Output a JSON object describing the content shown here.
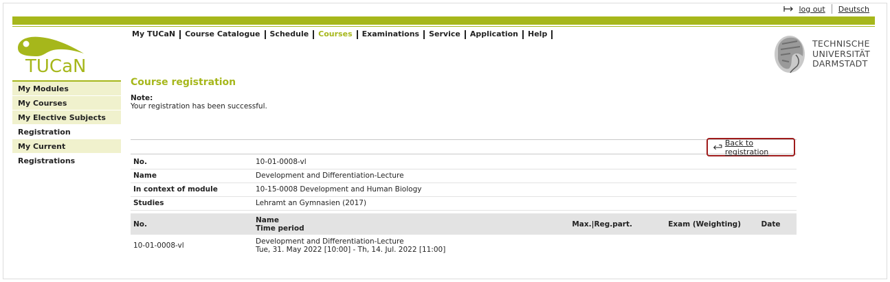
{
  "header": {
    "logout_label": "log out",
    "language_label": "Deutsch",
    "logo_text": "TUCaN",
    "university": [
      "TECHNISCHE",
      "UNIVERSITÄT",
      "DARMSTADT"
    ]
  },
  "nav": {
    "items": [
      {
        "label": "My TUCaN",
        "active": false
      },
      {
        "label": "Course Catalogue",
        "active": false
      },
      {
        "label": "Schedule",
        "active": false
      },
      {
        "label": "Courses",
        "active": true
      },
      {
        "label": "Examinations",
        "active": false
      },
      {
        "label": "Service",
        "active": false
      },
      {
        "label": "Application",
        "active": false
      },
      {
        "label": "Help",
        "active": false
      }
    ]
  },
  "sidebar": {
    "items": [
      {
        "label": "My Modules",
        "current": false
      },
      {
        "label": "My Courses",
        "current": false
      },
      {
        "label": "My Elective Subjects",
        "current": false
      },
      {
        "label": "Registration",
        "current": true
      },
      {
        "label": "My Current Registrations",
        "current": false
      }
    ]
  },
  "main": {
    "title": "Course registration",
    "note_label": "Note:",
    "note_text": "Your registration has been successful.",
    "back_label": "Back to registration",
    "details": [
      {
        "key": "No.",
        "value": "10-01-0008-vl"
      },
      {
        "key": "Name",
        "value": "Development and Differentiation-Lecture"
      },
      {
        "key": "In context of module",
        "value": "10-15-0008 Development and Human Biology"
      },
      {
        "key": "Studies",
        "value": "Lehramt an Gymnasien (2017)"
      }
    ],
    "table": {
      "headers": {
        "no": "No.",
        "name": "Name",
        "time_period": "Time period",
        "maxreg": "Max.|Reg.part.",
        "exam": "Exam  (Weighting)",
        "date": "Date"
      },
      "rows": [
        {
          "no": "10-01-0008-vl",
          "name": "Development and Differentiation-Lecture",
          "period": "Tue, 31. May 2022 [10:00] - Th, 14. Jul. 2022 [11:00]",
          "maxreg": "",
          "exam": "",
          "date": ""
        }
      ]
    }
  },
  "colors": {
    "accent": "#a6b71b",
    "highlight_border": "#9e1a1a",
    "sidebar_bg": "#f0f1cd"
  }
}
